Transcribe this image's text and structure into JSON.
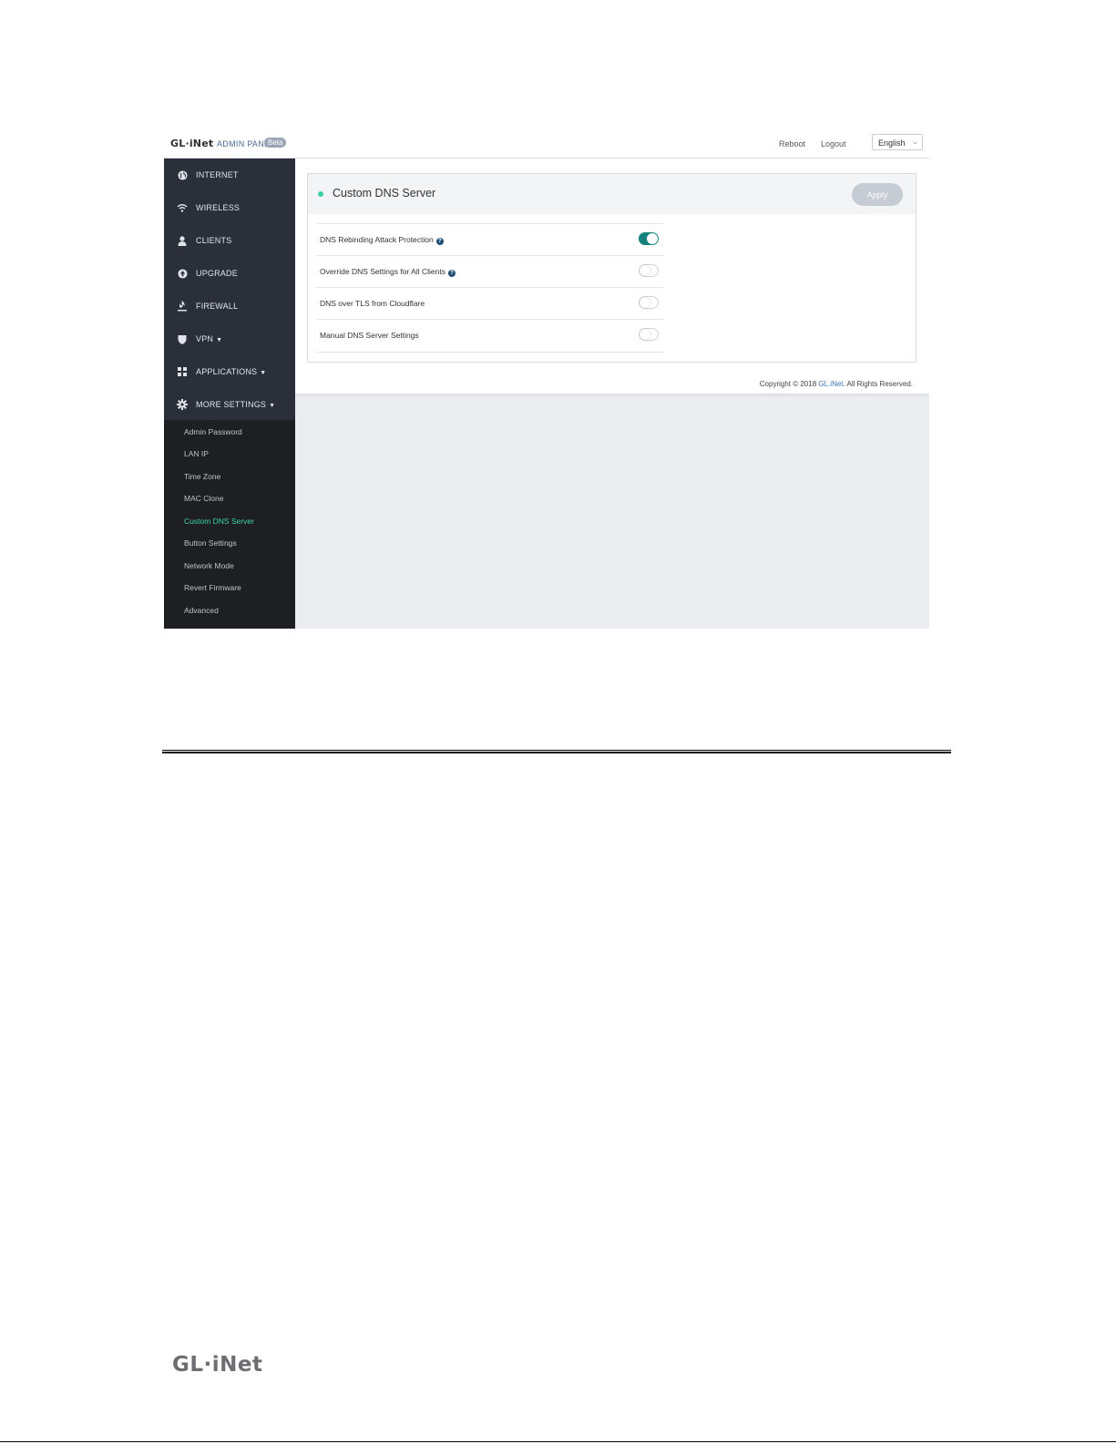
{
  "header": {
    "brand": "GL·iNet",
    "panel_label": "ADMIN PANEL",
    "beta_badge": "Beta",
    "reboot": "Reboot",
    "logout": "Logout",
    "language": "English"
  },
  "sidebar": {
    "items": [
      {
        "label": "INTERNET",
        "icon": "globe-icon"
      },
      {
        "label": "WIRELESS",
        "icon": "wifi-icon"
      },
      {
        "label": "CLIENTS",
        "icon": "user-icon"
      },
      {
        "label": "UPGRADE",
        "icon": "upgrade-icon"
      },
      {
        "label": "FIREWALL",
        "icon": "fire-icon"
      },
      {
        "label": "VPN",
        "icon": "shield-icon",
        "has_dropdown": true
      },
      {
        "label": "APPLICATIONS",
        "icon": "grid-icon",
        "has_dropdown": true
      },
      {
        "label": "MORE SETTINGS",
        "icon": "gear-icon",
        "has_dropdown": true
      }
    ],
    "submenu": [
      "Admin Password",
      "LAN IP",
      "Time Zone",
      "MAC Clone",
      "Custom DNS Server",
      "Button Settings",
      "Network Mode",
      "Revert Firmware",
      "Advanced"
    ],
    "active_submenu": "Custom DNS Server"
  },
  "card": {
    "title": "Custom DNS Server",
    "apply": "Apply",
    "rows": [
      {
        "label": "DNS Rebinding Attack Protection",
        "help": true,
        "enabled": true
      },
      {
        "label": "Override DNS Settings for All Clients",
        "help": true,
        "enabled": false
      },
      {
        "label": "DNS over TLS from Cloudflare",
        "help": false,
        "enabled": false
      },
      {
        "label": "Manual DNS Server Settings",
        "help": false,
        "enabled": false
      }
    ]
  },
  "footer": {
    "copyright_prefix": "Copyright © 2018 ",
    "copyright_brand": "GL.iNet",
    "copyright_suffix": ". All Rights Reserved."
  },
  "page_footer_logo": "GL·iNet",
  "colors": {
    "accent_green": "#3ad6a8",
    "toggle_on": "#12827b",
    "sidebar_bg": "#2b2f3a",
    "submenu_bg": "#1e1f23"
  }
}
